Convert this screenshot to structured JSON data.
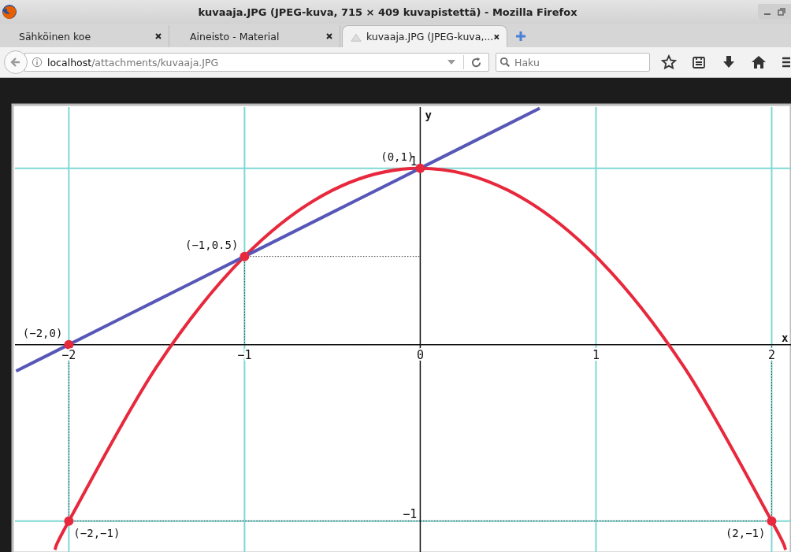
{
  "window": {
    "title": "kuvaaja.JPG (JPEG-kuva, 715 × 409 kuvapistettä) - Mozilla Firefox"
  },
  "tabs": [
    {
      "label": "Sähköinen koe",
      "selected": false
    },
    {
      "label": "Aineisto - Material",
      "selected": false
    },
    {
      "label": "kuvaaja.JPG (JPEG-kuva,...",
      "selected": true
    }
  ],
  "address_bar": {
    "host": "localhost",
    "path": "/attachments/kuvaaja.JPG"
  },
  "search": {
    "placeholder": "Haku"
  },
  "image": {
    "chart_data": {
      "type": "line",
      "xlabel": "x",
      "ylabel": "y",
      "x": [
        -2.3,
        -2.08,
        -2,
        -1.5,
        -1,
        -0.5,
        0,
        0.5,
        0.68,
        1,
        1.5,
        2,
        2.08
      ],
      "series": [
        {
          "color": "#e8283c",
          "values": [
            null,
            -1.163,
            -1,
            -0.125,
            0.5,
            0.875,
            1,
            0.875,
            null,
            0.5,
            -0.125,
            -1,
            -1.163
          ]
        },
        {
          "color": "#5757b8",
          "values": [
            -0.15,
            -0.04,
            0,
            0.25,
            0.5,
            0.75,
            1,
            1.25,
            1.34,
            null,
            null,
            null,
            null
          ]
        }
      ],
      "grid": true,
      "xlim": [
        -2.32,
        2.11
      ],
      "ylim": [
        -1.18,
        1.36
      ],
      "xticks": [
        {
          "value": -2,
          "label": "−2"
        },
        {
          "value": -1,
          "label": "−1"
        },
        {
          "value": 0,
          "label": "0"
        },
        {
          "value": 1,
          "label": "1"
        },
        {
          "value": 2,
          "label": "2"
        }
      ],
      "yticks": [
        {
          "value": 1,
          "label": "1"
        },
        {
          "value": -1,
          "label": "−1"
        }
      ],
      "annotations": [
        {
          "x": 0,
          "y": 1,
          "text": "(0,1)"
        },
        {
          "x": -1,
          "y": 0.5,
          "text": "(−1,0.5)"
        },
        {
          "x": -2,
          "y": 0,
          "text": "(−2,0)"
        },
        {
          "x": -2,
          "y": -1,
          "text": "(−2,−1)"
        },
        {
          "x": 2,
          "y": -1,
          "text": "(2,−1)"
        }
      ]
    }
  }
}
